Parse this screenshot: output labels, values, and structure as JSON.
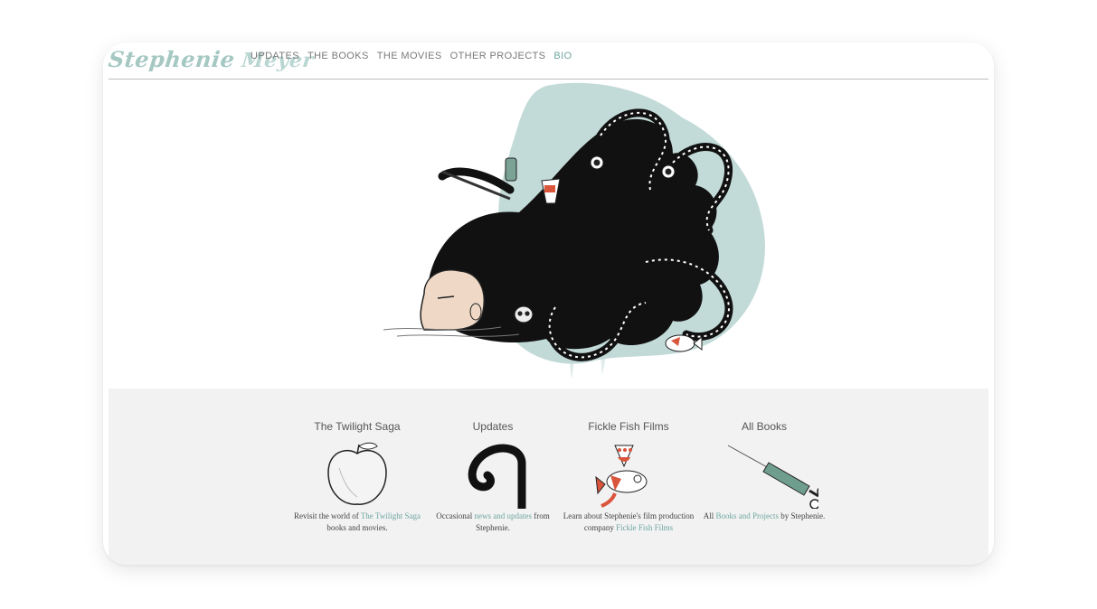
{
  "header": {
    "logo_first": "Stephenie",
    "logo_second": "Meyer",
    "nav": [
      "UPDATES",
      "THE BOOKS",
      "THE MOVIES",
      "OTHER PROJECTS",
      "BIO"
    ]
  },
  "cards": [
    {
      "title": "The Twilight Saga",
      "text_before": "Revisit the world of ",
      "link": "The Twilight Saga",
      "text_after": " books and movies.",
      "icon": "apple-icon"
    },
    {
      "title": "Updates",
      "text_before": "Occasional ",
      "link": "news and updates",
      "text_after": " from Stephenie.",
      "icon": "tentacle-icon"
    },
    {
      "title": "Fickle Fish Films",
      "text_before": "Learn about Stephenie's film production company ",
      "link": "Fickle Fish Films",
      "text_after": "",
      "icon": "fish-icon"
    },
    {
      "title": "All Books",
      "text_before": "All ",
      "link": "Books and Projects",
      "text_after": " by Stephenie.",
      "icon": "syringe-icon"
    }
  ],
  "colors": {
    "accent": "#6fa7a0",
    "watercolor": "#b7d3d1",
    "panel": "#f2f2f2"
  }
}
